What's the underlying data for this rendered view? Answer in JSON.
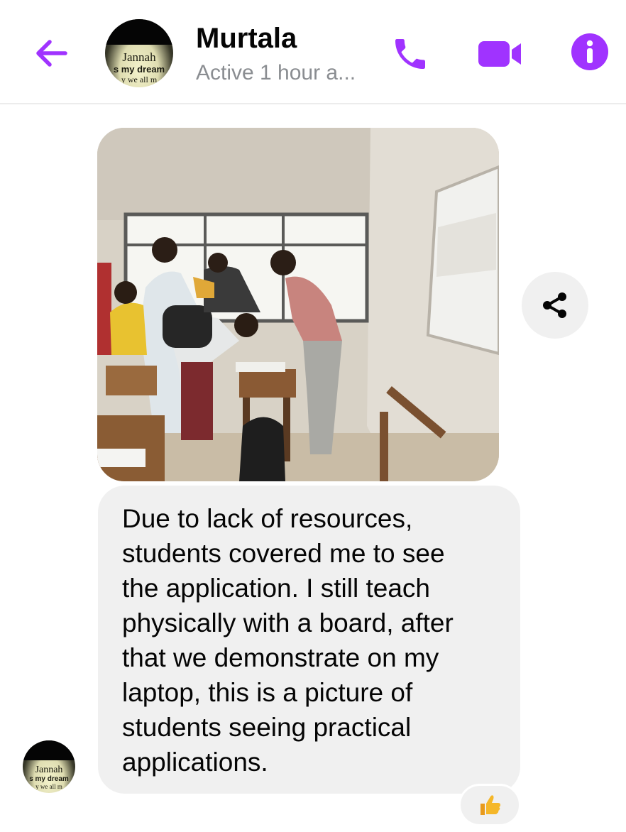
{
  "header": {
    "back_icon": "arrow-left-icon",
    "contact_name": "Murtala",
    "status": "Active 1 hour a...",
    "avatar": {
      "line1": "Jannah",
      "line2": "s my dream",
      "line3": "y we all m"
    },
    "actions": [
      {
        "name": "call",
        "icon": "phone-icon"
      },
      {
        "name": "video",
        "icon": "video-camera-icon"
      },
      {
        "name": "info",
        "icon": "info-icon"
      }
    ],
    "accent_color": "#a033ff"
  },
  "conversation": {
    "photo": {
      "description_icon": "image-attachment"
    },
    "share_icon": "share-icon",
    "message": {
      "text": "Due to lack of resources,\nstudents covered me to see\nthe application. I still teach\nphysically with a board, after\nthat we demonstrate on my\nlaptop, this is a picture of\nstudents seeing practical\napplications."
    },
    "sender_avatar": {
      "line1": "Jannah",
      "line2": "s my dream",
      "line3": "y we all m"
    },
    "reaction": {
      "icon": "thumbs-up-icon",
      "emoji": "👍"
    }
  }
}
